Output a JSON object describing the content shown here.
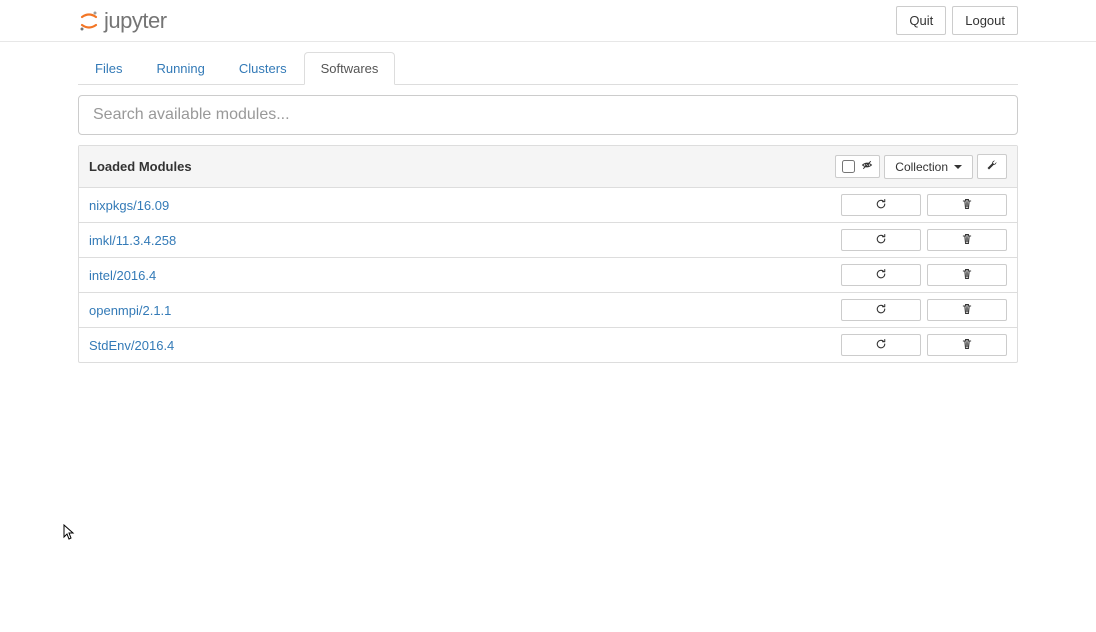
{
  "header": {
    "logo_text": "jupyter",
    "quit_label": "Quit",
    "logout_label": "Logout"
  },
  "tabs": [
    {
      "label": "Files",
      "active": false
    },
    {
      "label": "Running",
      "active": false
    },
    {
      "label": "Clusters",
      "active": false
    },
    {
      "label": "Softwares",
      "active": true
    }
  ],
  "search": {
    "placeholder": "Search available modules..."
  },
  "panel": {
    "title": "Loaded Modules",
    "collection_label": "Collection"
  },
  "modules": [
    {
      "name": "nixpkgs/16.09"
    },
    {
      "name": "imkl/11.3.4.258"
    },
    {
      "name": "intel/2016.4"
    },
    {
      "name": "openmpi/2.1.1"
    },
    {
      "name": "StdEnv/2016.4"
    }
  ]
}
